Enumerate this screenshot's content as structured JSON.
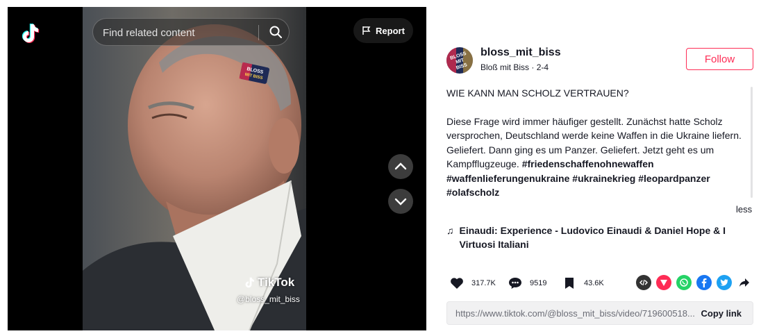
{
  "search": {
    "placeholder": "Find related content"
  },
  "report": {
    "label": "Report"
  },
  "video": {
    "watermark_brand": "TikTok",
    "watermark_user": "@bloss_mit_biss",
    "sticker_text": "BLOSS MIT BISS"
  },
  "author": {
    "username": "bloss_mit_biss",
    "nickname": "Bloß mit Biss",
    "separator": "·",
    "date": "2-4",
    "avatar_text": "BLOSS MIT BISS",
    "follow_label": "Follow"
  },
  "description": {
    "title": "WIE KANN MAN SCHOLZ VERTRAUEN?",
    "body": "Diese Frage wird immer häufiger gestellt. Zunächst hatte Scholz versprochen, Deutschland werde keine Waffen in die Ukraine liefern. Geliefert. Dann ging es um Panzer. Geliefert. Jetzt geht es um Kampfflugzeuge. ",
    "hashtags": [
      "#friedenschaffenohnewaffen",
      "#waffenlieferungenukraine",
      "#ukrainekrieg",
      "#leopardpanzer",
      "#olafscholz"
    ],
    "less_label": "less"
  },
  "music": {
    "note": "♫",
    "title": "Einaudi: Experience - Ludovico Einaudi & Daniel Hope & I Virtuosi Italiani"
  },
  "stats": {
    "likes": "317.7K",
    "comments": "9519",
    "saves": "43.6K"
  },
  "share": {
    "icons": [
      "embed-icon",
      "send-icon",
      "whatsapp-icon",
      "facebook-icon",
      "twitter-icon",
      "share-arrow-icon"
    ],
    "colors": {
      "embed": "#333333",
      "send": "#fe2c55",
      "whatsapp": "#25d366",
      "facebook": "#1877f2",
      "twitter": "#1da1f2"
    }
  },
  "link": {
    "url": "https://www.tiktok.com/@bloss_mit_biss/video/719600518...",
    "copy_label": "Copy link"
  },
  "colors": {
    "accent": "#fe2c55",
    "text": "#161823",
    "muted": "#6b6d76"
  }
}
